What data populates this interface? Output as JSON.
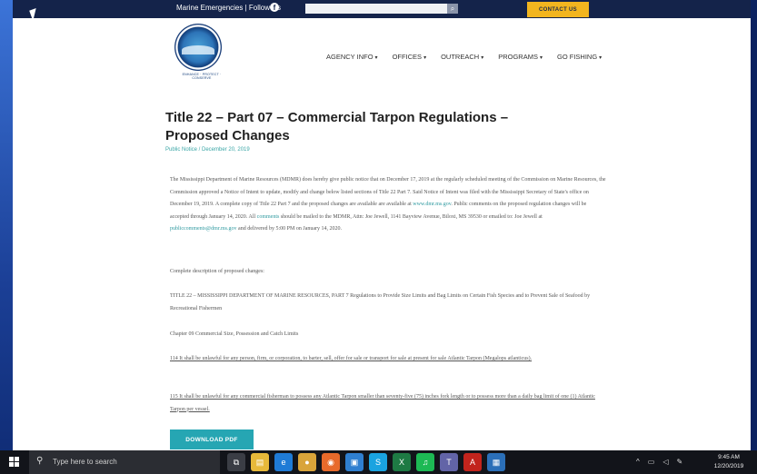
{
  "topbar": {
    "emergencies_text": "Marine Emergencies | Follow Us",
    "contact_label": "CONTACT US"
  },
  "logo": {
    "tagline": "ENHANCE · PROTECT · CONSERVE"
  },
  "nav": [
    {
      "label": "AGENCY INFO",
      "chev": "▾"
    },
    {
      "label": "OFFICES",
      "chev": "▾"
    },
    {
      "label": "OUTREACH",
      "chev": "▾"
    },
    {
      "label": "PROGRAMS",
      "chev": "▾"
    },
    {
      "label": "GO FISHING",
      "chev": "▾"
    }
  ],
  "article": {
    "title": "Title 22 – Part 07 – Commercial Tarpon Regulations – Proposed Changes",
    "meta": "Public Notice / December 20, 2019",
    "p1_a": "The Mississippi Department of Marine Resources (MDMR) does hereby give public notice that on December 17, 2019 at the regularly scheduled meeting of the Commission on Marine Resources, the Commission approved a Notice of Intent to update, modify and change below listed sections of Title 22 Part 7. Said Notice of Intent was filed with the Mississippi Secretary of State's office on December 19, 2019. A complete copy of Title 22 Part 7 and the proposed changes are available are available at ",
    "p1_link1": "www.dmr.ms.gov",
    "p1_b": ". Public comments on the proposed regulation changes will be accepted through January 14, 2020. All ",
    "p1_link2": "comments",
    "p1_c": " should be mailed to the MDMR, Attn: Joe Jewell, 1141 Bayview Avenue, Biloxi, MS 39530 or emailed to: Joe Jewell at ",
    "p1_link3": "publiccomments@dmr.ms.gov",
    "p1_d": " and delivered by 5:00 PM on January 14, 2020.",
    "p2": "Complete description of proposed changes:",
    "p3": "TITLE 22 – MISSISSIPPI DEPARTMENT OF MARINE RESOURCES, PART 7 Regulations to Provide Size Limits and Bag Limits on Certain Fish Species and to Prevent Sale of Seafood by Recreational Fishermen",
    "p4": "Chapter 09 Commercial Size, Possession and Catch Limits",
    "p5": "114 It shall be unlawful for any person, firm, or corporation, to barter, sell, offer for sale or transport for sale at present for sale Atlantic Tarpon (Megalops atlanticus).",
    "p6": "115 It shall be unlawful for any commercial fisherman to possess any Atlantic Tarpon smaller than seventy-five (75) inches fork length or to possess more than a daily bag limit of one (1) Atlantic Tarpon per vessel.",
    "download_label": "DOWNLOAD PDF"
  },
  "taskbar": {
    "search_placeholder": "Type here to search",
    "apps": [
      {
        "name": "task-view-icon",
        "glyph": "⧉",
        "color": "#3a3d45"
      },
      {
        "name": "file-explorer-icon",
        "glyph": "▤",
        "color": "#e7b93a"
      },
      {
        "name": "edge-icon",
        "glyph": "e",
        "color": "#1f7bd6"
      },
      {
        "name": "chrome-icon",
        "glyph": "●",
        "color": "#d9a43a"
      },
      {
        "name": "firefox-icon",
        "glyph": "◉",
        "color": "#e86a2b"
      },
      {
        "name": "store-icon",
        "glyph": "▣",
        "color": "#2f7fd0"
      },
      {
        "name": "skype-icon",
        "glyph": "S",
        "color": "#1aa3e0"
      },
      {
        "name": "excel-icon",
        "glyph": "X",
        "color": "#1e7a44"
      },
      {
        "name": "spotify-icon",
        "glyph": "♫",
        "color": "#1db954"
      },
      {
        "name": "teams-icon",
        "glyph": "T",
        "color": "#6264a7"
      },
      {
        "name": "acrobat-icon",
        "glyph": "A",
        "color": "#c2241d"
      },
      {
        "name": "app-icon",
        "glyph": "▦",
        "color": "#2b6fb8"
      }
    ],
    "time": "9:45 AM",
    "date": "12/20/2019"
  }
}
